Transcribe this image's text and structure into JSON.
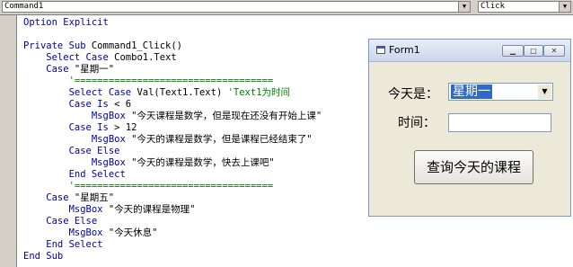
{
  "toolbar": {
    "object_combo": "Command1",
    "proc_combo": "Click",
    "arrow_glyph": "▼"
  },
  "code_lines": [
    [
      {
        "t": "Option Explicit",
        "c": "kw"
      }
    ],
    [],
    [
      {
        "t": "Private Sub ",
        "c": "kw"
      },
      {
        "t": "Command1_Click()"
      }
    ],
    [
      {
        "t": "    Select Case ",
        "c": "kw"
      },
      {
        "t": "Combo1.Text"
      }
    ],
    [
      {
        "t": "    Case ",
        "c": "kw"
      },
      {
        "t": "\"星期一\""
      }
    ],
    [
      {
        "t": "        '===================================",
        "c": "cm"
      }
    ],
    [
      {
        "t": "        Select Case ",
        "c": "kw"
      },
      {
        "t": "Val(Text1.Text) "
      },
      {
        "t": "'Text1为时间",
        "c": "cm"
      }
    ],
    [
      {
        "t": "        Case Is ",
        "c": "kw"
      },
      {
        "t": "< 6"
      }
    ],
    [
      {
        "t": "            MsgBox ",
        "c": "kw"
      },
      {
        "t": "\"今天课程是数学，但是现在还没有开始上课\""
      }
    ],
    [
      {
        "t": "        Case Is ",
        "c": "kw"
      },
      {
        "t": "> 12"
      }
    ],
    [
      {
        "t": "            MsgBox ",
        "c": "kw"
      },
      {
        "t": "\"今天的课程是数学，但是课程已经结束了\""
      }
    ],
    [
      {
        "t": "        Case Else",
        "c": "kw"
      }
    ],
    [
      {
        "t": "            MsgBox ",
        "c": "kw"
      },
      {
        "t": "\"今天的课程是数学，快去上课吧\""
      }
    ],
    [
      {
        "t": "        End Select",
        "c": "kw"
      }
    ],
    [
      {
        "t": "        '===================================",
        "c": "cm"
      }
    ],
    [
      {
        "t": "    Case ",
        "c": "kw"
      },
      {
        "t": "\"星期五\""
      }
    ],
    [
      {
        "t": "        MsgBox ",
        "c": "kw"
      },
      {
        "t": "\"今天的课程是物理\""
      }
    ],
    [
      {
        "t": "    Case Else",
        "c": "kw"
      }
    ],
    [
      {
        "t": "        MsgBox ",
        "c": "kw"
      },
      {
        "t": "\"今天休息\""
      }
    ],
    [
      {
        "t": "    End Select",
        "c": "kw"
      }
    ],
    [
      {
        "t": "End Sub",
        "c": "kw"
      }
    ]
  ],
  "form": {
    "title": "Form1",
    "minimize_glyph": "▁",
    "maximize_glyph": "□",
    "close_glyph": "✕",
    "day_label": "今天是：",
    "day_value": "星期一",
    "day_arrow": "▼",
    "time_label": "时间：",
    "time_value": "",
    "query_button": "查询今天的课程"
  },
  "colors": {
    "keyword": "#0000a0",
    "comment": "#008000",
    "selection": "#316ac5"
  }
}
